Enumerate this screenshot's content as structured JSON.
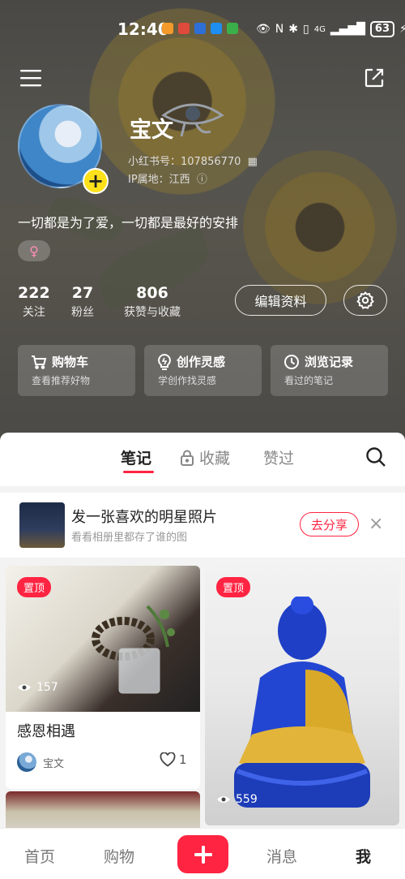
{
  "status_bar": {
    "time": "12:40",
    "battery": "63",
    "network": "4G"
  },
  "profile": {
    "name": "宝文",
    "id_label": "小红书号：107856770",
    "ip_label": "IP属地：江西",
    "bio": "一切都是为了爱，一切都是最好的安排",
    "gender_symbol": "♀"
  },
  "stats": [
    {
      "value": "222",
      "label": "关注"
    },
    {
      "value": "27",
      "label": "粉丝"
    },
    {
      "value": "806",
      "label": "获赞与收藏"
    }
  ],
  "edit_button": "编辑资料",
  "quick_links": [
    {
      "title": "购物车",
      "subtitle": "查看推荐好物",
      "icon": "cart-icon"
    },
    {
      "title": "创作灵感",
      "subtitle": "学创作找灵感",
      "icon": "bulb-icon"
    },
    {
      "title": "浏览记录",
      "subtitle": "看过的笔记",
      "icon": "clock-icon"
    }
  ],
  "tabs": {
    "notes": "笔记",
    "collect": "收藏",
    "likes": "赞过"
  },
  "promo": {
    "title": "发一张喜欢的明星照片",
    "subtitle": "看看相册里都存了谁的图",
    "action": "去分享",
    "close": "×"
  },
  "cards": [
    {
      "pin": "置顶",
      "views": "157",
      "title": "感恩相遇",
      "author": "宝文",
      "likes": "1"
    },
    {
      "pin": "置顶",
      "views": "559"
    }
  ],
  "bottom_nav": {
    "home": "首页",
    "shop": "购物",
    "add": "+",
    "messages": "消息",
    "me": "我"
  },
  "colors": {
    "accent": "#ff2442",
    "badge": "#ffe11a"
  }
}
